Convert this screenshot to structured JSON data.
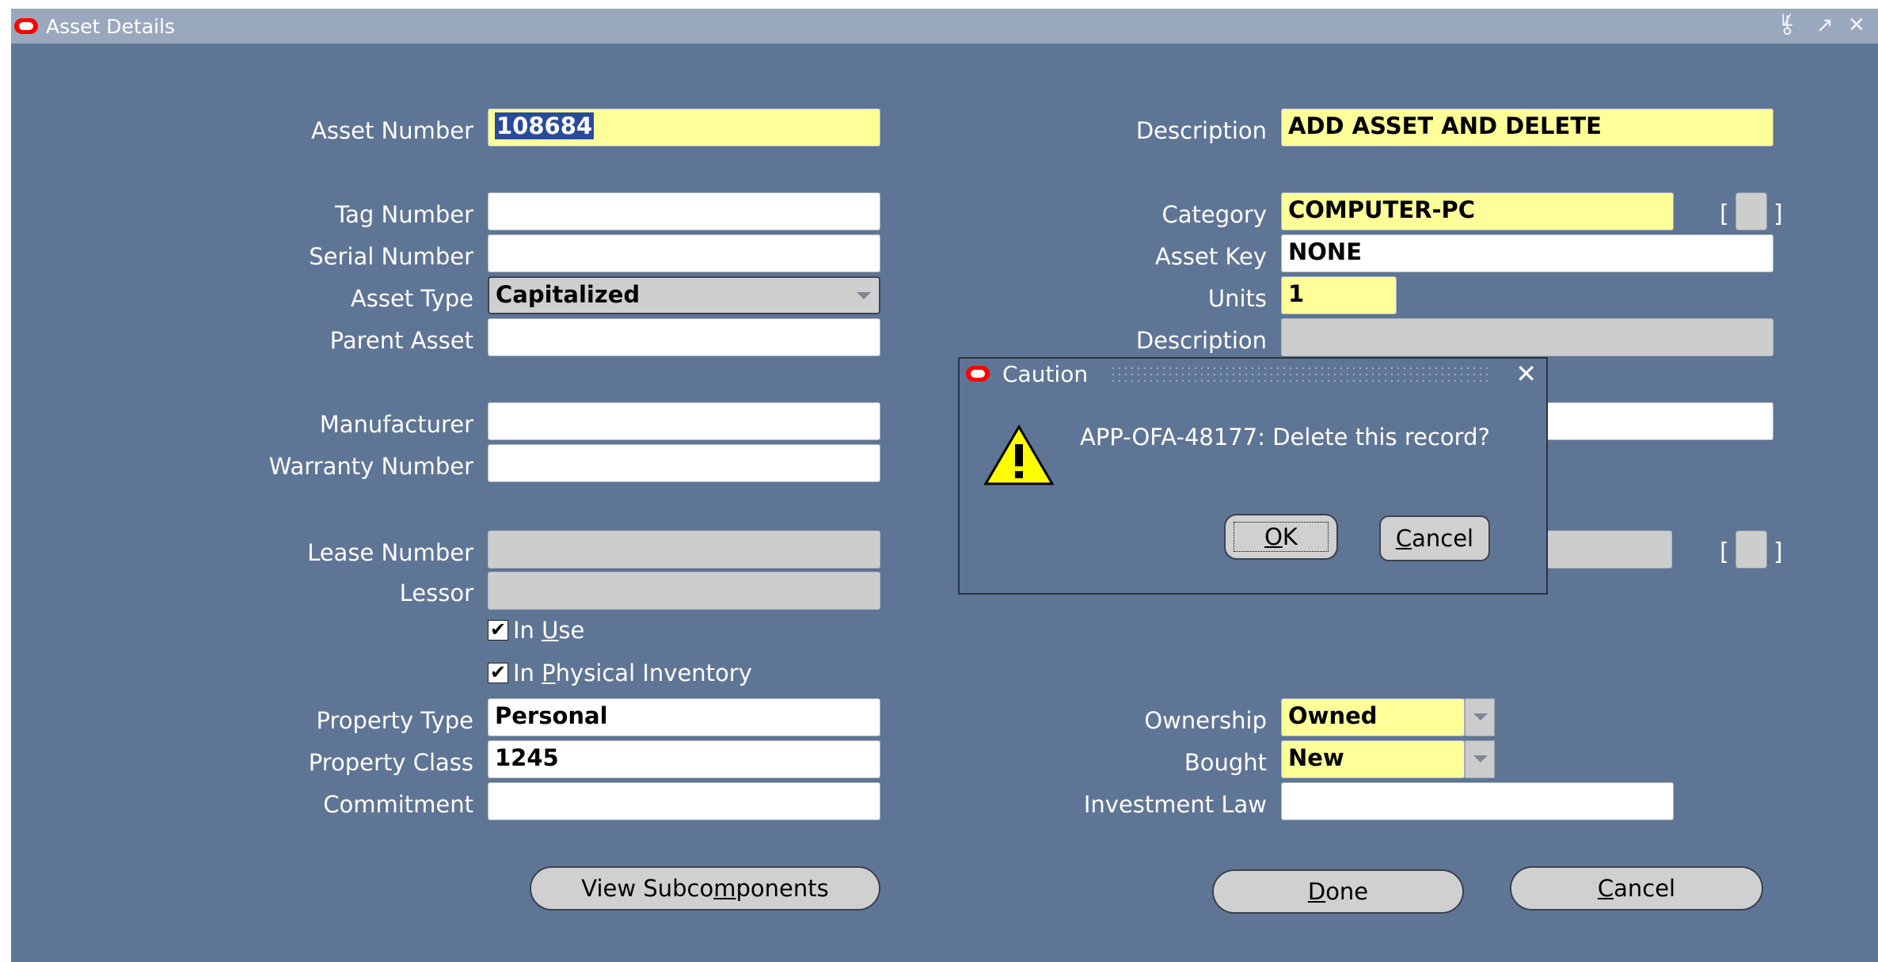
{
  "window": {
    "title": "Asset Details",
    "controls": {
      "minimize": "⯉",
      "restore": "↗",
      "close": "✕"
    }
  },
  "left": {
    "asset_number": {
      "label": "Asset Number",
      "value": "108684"
    },
    "tag_number": {
      "label": "Tag Number",
      "value": ""
    },
    "serial_number": {
      "label": "Serial Number",
      "value": ""
    },
    "asset_type": {
      "label": "Asset Type",
      "value": "Capitalized"
    },
    "parent_asset": {
      "label": "Parent Asset",
      "value": ""
    },
    "manufacturer": {
      "label": "Manufacturer",
      "value": ""
    },
    "warranty_number": {
      "label": "Warranty Number",
      "value": ""
    },
    "lease_number": {
      "label": "Lease Number",
      "value": ""
    },
    "lessor": {
      "label": "Lessor",
      "value": ""
    },
    "in_use": {
      "label_pre": "In ",
      "label_key": "U",
      "label_post": "se",
      "checked": true
    },
    "in_physical_inventory": {
      "label_pre": "In ",
      "label_key": "P",
      "label_post": "hysical Inventory",
      "checked": true
    },
    "property_type": {
      "label": "Property Type",
      "value": "Personal"
    },
    "property_class": {
      "label": "Property Class",
      "value": "1245"
    },
    "commitment": {
      "label": "Commitment",
      "value": ""
    }
  },
  "right": {
    "description": {
      "label": "Description",
      "value": "ADD ASSET AND DELETE"
    },
    "category": {
      "label": "Category",
      "value": "COMPUTER-PC"
    },
    "asset_key": {
      "label": "Asset Key",
      "value": "NONE"
    },
    "units": {
      "label": "Units",
      "value": "1"
    },
    "description2": {
      "label": "Description",
      "value": ""
    },
    "ownership": {
      "label": "Ownership",
      "value": "Owned"
    },
    "bought": {
      "label": "Bought",
      "value": "New"
    },
    "investment_law": {
      "label": "Investment Law",
      "value": ""
    },
    "flex_bracket_open": "[",
    "flex_bracket_close": "]"
  },
  "buttons": {
    "view_subcomponents": {
      "pre": "View Subco",
      "key": "m",
      "post": "ponents"
    },
    "done": {
      "pre": "",
      "key": "D",
      "post": "one"
    },
    "cancel": {
      "pre": "",
      "key": "C",
      "post": "ancel"
    }
  },
  "dialog": {
    "title": "Caution",
    "close": "✕",
    "message": "APP-OFA-48177: Delete this record?",
    "ok": {
      "key": "O",
      "post": "K"
    },
    "cancel": {
      "key": "C",
      "post": "ancel"
    },
    "icon": "warning-icon"
  },
  "colors": {
    "window_bg": "#5f7595",
    "titlebar_bg": "#9aa8be",
    "required_field": "#ffff9a",
    "disabled_field": "#cdcdcd",
    "logo_red": "#ff0000"
  }
}
